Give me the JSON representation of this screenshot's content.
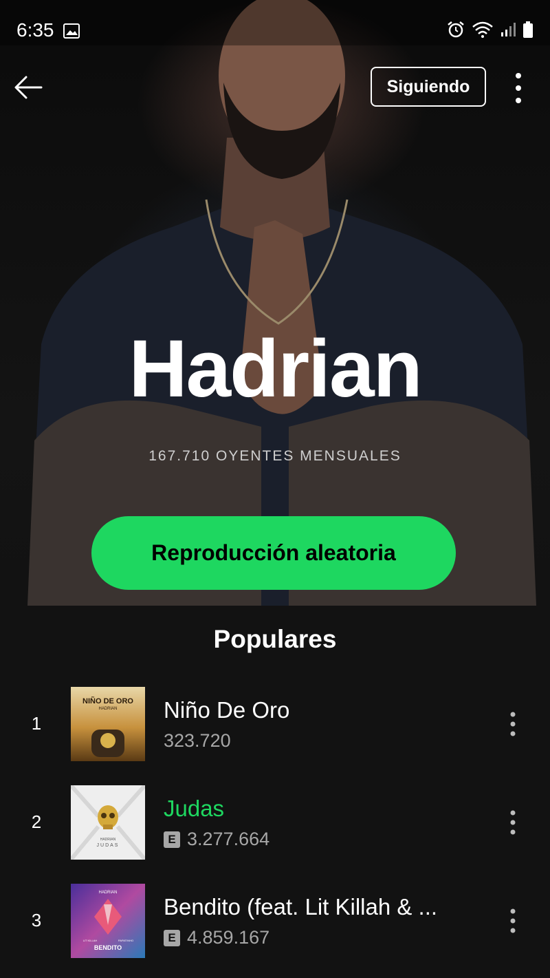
{
  "status_bar": {
    "time": "6:35",
    "icons": [
      "gallery-icon",
      "alarm-icon",
      "wifi-icon",
      "signal-icon",
      "battery-icon"
    ]
  },
  "header": {
    "follow_label": "Siguiendo",
    "back_icon": "arrow-left-icon",
    "more_icon": "vertical-dots-icon"
  },
  "artist": {
    "name": "Hadrian",
    "monthly_listeners": "167.710 OYENTES MENSUALES"
  },
  "shuffle_label": "Reproducción aleatoria",
  "popular": {
    "title": "Populares",
    "tracks": [
      {
        "number": "1",
        "title": "Niño De Oro",
        "plays": "323.720",
        "explicit": false,
        "playing": false,
        "cover_text": "NIÑO DE ORO",
        "cover_sub": "HADRIAN"
      },
      {
        "number": "2",
        "title": "Judas",
        "plays": "3.277.664",
        "explicit": true,
        "explicit_label": "E",
        "playing": true,
        "cover_text": "JUDAS",
        "cover_sub": "HADRIAN"
      },
      {
        "number": "3",
        "title": "Bendito (feat. Lit Killah & ...",
        "plays": "4.859.167",
        "explicit": true,
        "explicit_label": "E",
        "playing": false,
        "cover_text": "BENDITO",
        "cover_sub": "HADRIAN",
        "cover_sub2_left": "LIT KILLAH",
        "cover_sub2_right": "PAPATINHO"
      }
    ]
  },
  "colors": {
    "background": "#121212",
    "accent": "#1ed760",
    "secondary_text": "#a7a7a7"
  }
}
